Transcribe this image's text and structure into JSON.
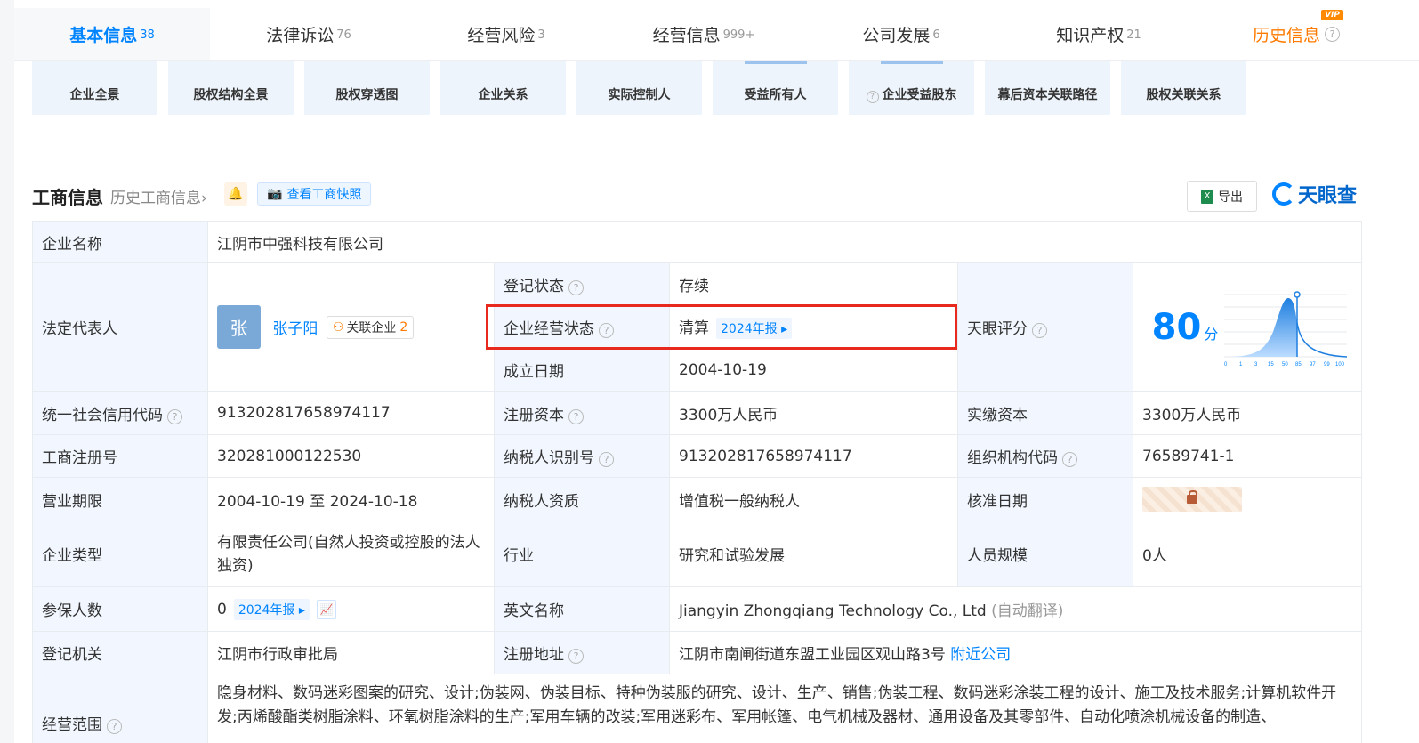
{
  "tabs": [
    {
      "label": "基本信息",
      "count": "38"
    },
    {
      "label": "法律诉讼",
      "count": "76"
    },
    {
      "label": "经营风险",
      "count": "3"
    },
    {
      "label": "经营信息",
      "count": "999+"
    },
    {
      "label": "公司发展",
      "count": "6"
    },
    {
      "label": "知识产权",
      "count": "21"
    },
    {
      "label": "历史信息",
      "badge": "VIP"
    }
  ],
  "cards": [
    "企业全景",
    "股权结构全景",
    "股权穿透图",
    "企业关系",
    "实际控制人",
    "受益所有人",
    "企业受益股东",
    "幕后资本关联路径",
    "股权关联关系"
  ],
  "section": {
    "title": "工商信息",
    "history_link": "历史工商信息",
    "snapshot": "查看工商快照",
    "export": "导出",
    "brand": "天眼查"
  },
  "info": {
    "company_name_label": "企业名称",
    "company_name": "江阴市中强科技有限公司",
    "legal_rep_label": "法定代表人",
    "legal_rep_avatar": "张",
    "legal_rep_name": "张子阳",
    "related_label": "关联企业",
    "related_count": "2",
    "reg_status_label": "登记状态",
    "reg_status": "存续",
    "op_status_label": "企业经营状态",
    "op_status": "清算",
    "op_status_tag": "2024年报",
    "founded_label": "成立日期",
    "founded": "2004-10-19",
    "score_label": "天眼评分",
    "score": "80",
    "score_unit": "分",
    "credit_code_label": "统一社会信用代码",
    "credit_code": "913202817658974117",
    "reg_capital_label": "注册资本",
    "reg_capital": "3300万人民币",
    "paid_capital_label": "实缴资本",
    "paid_capital": "3300万人民币",
    "reg_no_label": "工商注册号",
    "reg_no": "320281000122530",
    "taxpayer_id_label": "纳税人识别号",
    "taxpayer_id": "913202817658974117",
    "org_code_label": "组织机构代码",
    "org_code": "76589741-1",
    "term_label": "营业期限",
    "term": "2004-10-19 至 2024-10-18",
    "tax_qual_label": "纳税人资质",
    "tax_qual": "增值税一般纳税人",
    "approve_label": "核准日期",
    "type_label": "企业类型",
    "type": "有限责任公司(自然人投资或控股的法人独资)",
    "industry_label": "行业",
    "industry": "研究和试验发展",
    "staff_label": "人员规模",
    "staff": "0人",
    "insured_label": "参保人数",
    "insured": "0",
    "insured_tag": "2024年报",
    "en_name_label": "英文名称",
    "en_name": "Jiangyin Zhongqiang Technology Co., Ltd",
    "en_name_note": "(自动翻译)",
    "authority_label": "登记机关",
    "authority": "江阴市行政审批局",
    "address_label": "注册地址",
    "address": "江阴市南闸街道东盟工业园区观山路3号",
    "nearby": "附近公司",
    "scope_label": "经营范围",
    "scope": "隐身材料、数码迷彩图案的研究、设计;伪装网、伪装目标、特种伪装服的研究、设计、生产、销售;伪装工程、数码迷彩涂装工程的设计、施工及技术服务;计算机软件开发;丙烯酸酯类树脂涂料、环氧树脂涂料的生产;军用车辆的改装;军用迷彩布、军用帐篷、电气机械及器材、通用设备及其零部件、自动化喷涂机械设备的制造、"
  },
  "score_chart": {
    "ticks": [
      "0",
      "1",
      "3",
      "15",
      "50",
      "85",
      "97",
      "99",
      "100"
    ]
  },
  "colors": {
    "accent": "#0084ff",
    "status_green": "#2fa84f",
    "history_orange": "#ff7a00",
    "highlight_red": "#e8291d"
  }
}
